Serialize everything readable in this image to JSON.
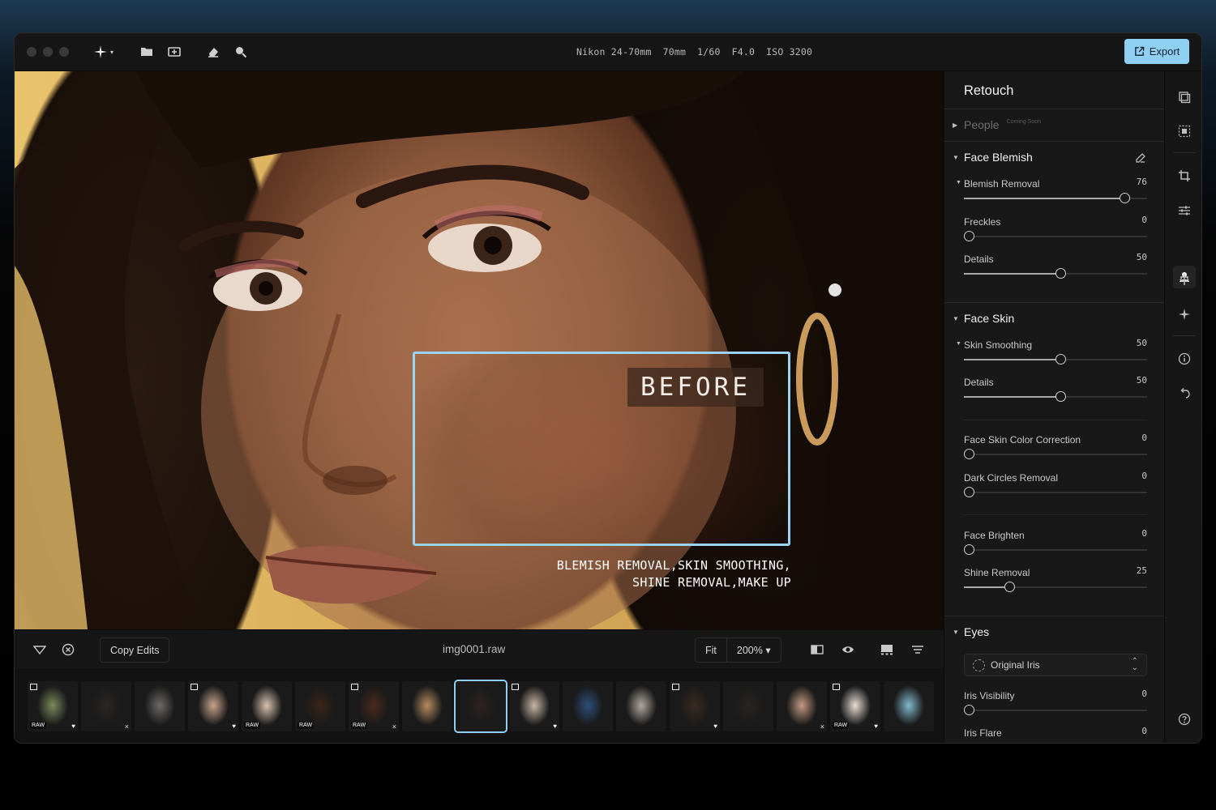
{
  "topbar": {
    "meta": [
      "Nikon 24-70mm",
      "70mm",
      "1/60",
      "F4.0",
      "ISO 3200"
    ],
    "export_label": "Export"
  },
  "photo": {
    "before_label": "BEFORE",
    "caption_line1": "BLEMISH REMOVAL,SKIN SMOOTHING,",
    "caption_line2": "SHINE REMOVAL,MAKE UP"
  },
  "bottombar": {
    "copy_edits": "Copy Edits",
    "filename": "img0001.raw",
    "fit": "Fit",
    "zoom": "200%"
  },
  "filmstrip": {
    "raw_badge": "RAW",
    "thumbs": [
      {
        "color": "#7a8a5a",
        "raw": true,
        "heart": true
      },
      {
        "color": "#2b2623",
        "x": true
      },
      {
        "color": "#6e6a66"
      },
      {
        "color": "#c7a48a",
        "raw": false,
        "heart": true
      },
      {
        "color": "#d7c2b0",
        "raw": true
      },
      {
        "color": "#3a2418",
        "raw": true
      },
      {
        "color": "#4a2a1c",
        "raw": true,
        "x": true
      },
      {
        "color": "#b58b5f"
      },
      {
        "color": "#2d2320"
      },
      {
        "color": "#c9b6a4",
        "heart": true
      },
      {
        "color": "#2b4f7a"
      },
      {
        "color": "#b0a79f"
      },
      {
        "color": "#3a2a22",
        "heart": true
      },
      {
        "color": "#2a2420"
      },
      {
        "color": "#c39a82",
        "x": true
      },
      {
        "color": "#e8dcd4",
        "raw": true,
        "heart": true
      },
      {
        "color": "#7fb8c9"
      }
    ]
  },
  "panel": {
    "title": "Retouch",
    "people": "People",
    "coming_soon": "Coming Soon",
    "face_blemish": {
      "header": "Face Blemish",
      "blemish_removal": {
        "label": "Blemish Removal",
        "value": "76",
        "level": 0.85
      },
      "freckles": {
        "label": "Freckles",
        "value": "0",
        "level": 0.0
      },
      "details": {
        "label": "Details",
        "value": "50",
        "level": 0.5
      }
    },
    "face_skin": {
      "header": "Face Skin",
      "skin_smoothing": {
        "label": "Skin Smoothing",
        "value": "50",
        "level": 0.5
      },
      "details": {
        "label": "Details",
        "value": "50",
        "level": 0.5
      },
      "color_correction": {
        "label": "Face Skin Color Correction",
        "value": "0",
        "level": 0.0
      },
      "dark_circles": {
        "label": "Dark Circles Removal",
        "value": "0",
        "level": 0.0
      },
      "brighten": {
        "label": "Face Brighten",
        "value": "0",
        "level": 0.0
      },
      "shine_removal": {
        "label": "Shine Removal",
        "value": "25",
        "level": 0.22
      }
    },
    "eyes": {
      "header": "Eyes",
      "iris_select": "Original Iris",
      "iris_visibility": {
        "label": "Iris Visibility",
        "value": "0",
        "level": 0.0
      },
      "iris_flare": {
        "label": "Iris Flare",
        "value": "0",
        "level": 0.0
      }
    }
  },
  "colors": {
    "accent": "#8fd0f2",
    "panel_bg": "#181818",
    "window_bg": "#161616"
  }
}
